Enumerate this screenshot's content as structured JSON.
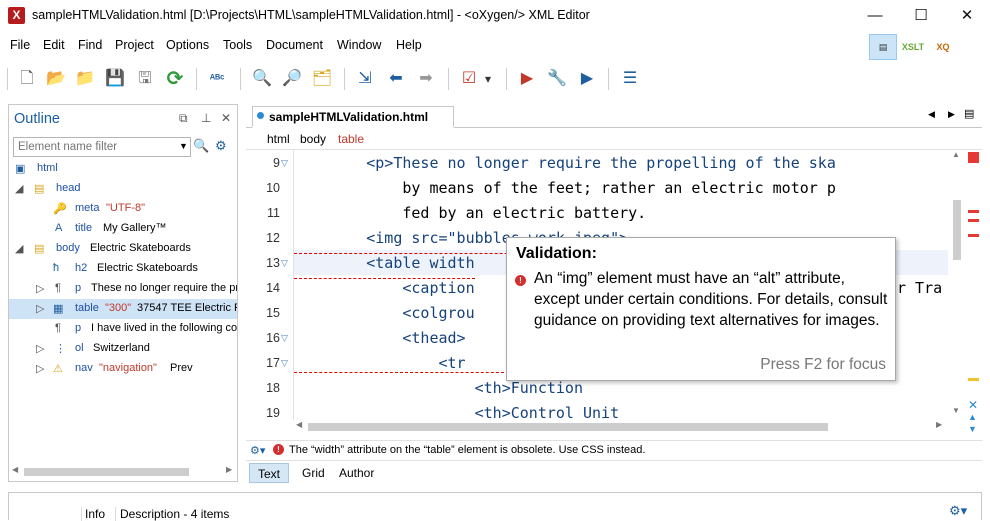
{
  "window": {
    "app_icon": "oxygen-app-icon",
    "title": "sampleHTMLValidation.html [D:\\Projects\\HTML\\sampleHTMLValidation.html] - <oXygen/> XML Editor",
    "minimize": "—",
    "maximize": "☐",
    "close": "✕"
  },
  "menu": [
    "File",
    "Edit",
    "Find",
    "Project",
    "Options",
    "Tools",
    "Document",
    "Window",
    "Help"
  ],
  "perspectives": [
    {
      "name": "editor-perspective-icon",
      "label": "▤",
      "active": true
    },
    {
      "name": "xslt-debugger-perspective-icon",
      "label": "XSLT",
      "active": false
    },
    {
      "name": "xquery-debugger-perspective-icon",
      "label": "XQ",
      "active": false
    }
  ],
  "toolbar": [
    {
      "name": "new-document-icon",
      "glyph": "🗋"
    },
    {
      "name": "open-folder-icon",
      "glyph": "📂"
    },
    {
      "name": "open-url-icon",
      "glyph": "📁"
    },
    {
      "name": "save-icon",
      "glyph": "💾"
    },
    {
      "name": "save-all-icon",
      "glyph": "🖫"
    },
    {
      "name": "reload-icon",
      "glyph": "⟳"
    },
    {
      "name": "spell-check-icon",
      "glyph": "ᴬᴮᶜ"
    },
    {
      "name": "find-icon",
      "glyph": "🔍"
    },
    {
      "name": "find-in-files-icon",
      "glyph": "🔎"
    },
    {
      "name": "find-folder-icon",
      "glyph": "🗂"
    },
    {
      "name": "import-icon",
      "glyph": "⇲"
    },
    {
      "name": "back-icon",
      "glyph": "⬅"
    },
    {
      "name": "forward-icon",
      "glyph": "➡"
    },
    {
      "name": "validate-icon",
      "glyph": "☑"
    },
    {
      "name": "validate-dropdown-icon",
      "glyph": "▾"
    },
    {
      "name": "apply-transformation-icon",
      "glyph": "▶"
    },
    {
      "name": "configure-transformation-icon",
      "glyph": "🔧"
    },
    {
      "name": "debug-transformation-icon",
      "glyph": "▶"
    },
    {
      "name": "format-indent-icon",
      "glyph": "☰"
    }
  ],
  "outline": {
    "title": "Outline",
    "filter_placeholder": "Element name filter",
    "rows": [
      {
        "tag": "html",
        "text": "",
        "attr": ""
      },
      {
        "tag": "head",
        "text": "",
        "attr": ""
      },
      {
        "tag": "meta",
        "text": "",
        "attr": "\"UTF-8\""
      },
      {
        "tag": "title",
        "text": "My Gallery™",
        "attr": ""
      },
      {
        "tag": "body",
        "text": "Electric Skateboards",
        "attr": ""
      },
      {
        "tag": "h2",
        "text": "Electric Skateboards",
        "attr": ""
      },
      {
        "tag": "p",
        "text": "These no longer require the pr",
        "attr": ""
      },
      {
        "tag": "table",
        "text": "37547 TEE Electric Po",
        "attr": "\"300\""
      },
      {
        "tag": "p",
        "text": "I have lived in the following co",
        "attr": ""
      },
      {
        "tag": "ol",
        "text": "Switzerland",
        "attr": ""
      },
      {
        "tag": "nav",
        "text": "Prev",
        "attr": "\"navigation\""
      }
    ]
  },
  "editor": {
    "tab_label": "sampleHTMLValidation.html",
    "breadcrumb": [
      "html",
      "body",
      "table"
    ],
    "line_numbers": [
      "9",
      "10",
      "11",
      "12",
      "13",
      "14",
      "15",
      "16",
      "17",
      "18",
      "19"
    ],
    "lines": [
      "        <p>These no longer require the propelling of the ska",
      "            by means of the feet; rather an electric motor p",
      "            fed by an electric battery.",
      "        <img src=\"bubbles-work.jpeg\">",
      "        <table width",
      "            <caption",
      "            <colgrou",
      "            <thead>",
      "                <tr",
      "                    <th>Function",
      "                    <th>Control Unit"
    ],
    "line14_tail": "r Tra",
    "problem_message": "The “width” attribute on the “table” element is obsolete. Use CSS instead.",
    "modes": [
      "Text",
      "Grid",
      "Author"
    ],
    "active_mode": "Text"
  },
  "tooltip": {
    "title": "Validation:",
    "message": "An “img” element must have an “alt” attribute, except under certain conditions. For details, consult guidance on providing text alternatives for images.",
    "hint": "Press F2 for focus"
  },
  "bottom_panel": {
    "info_label": "Info",
    "description_label": "Description - 4 items"
  }
}
